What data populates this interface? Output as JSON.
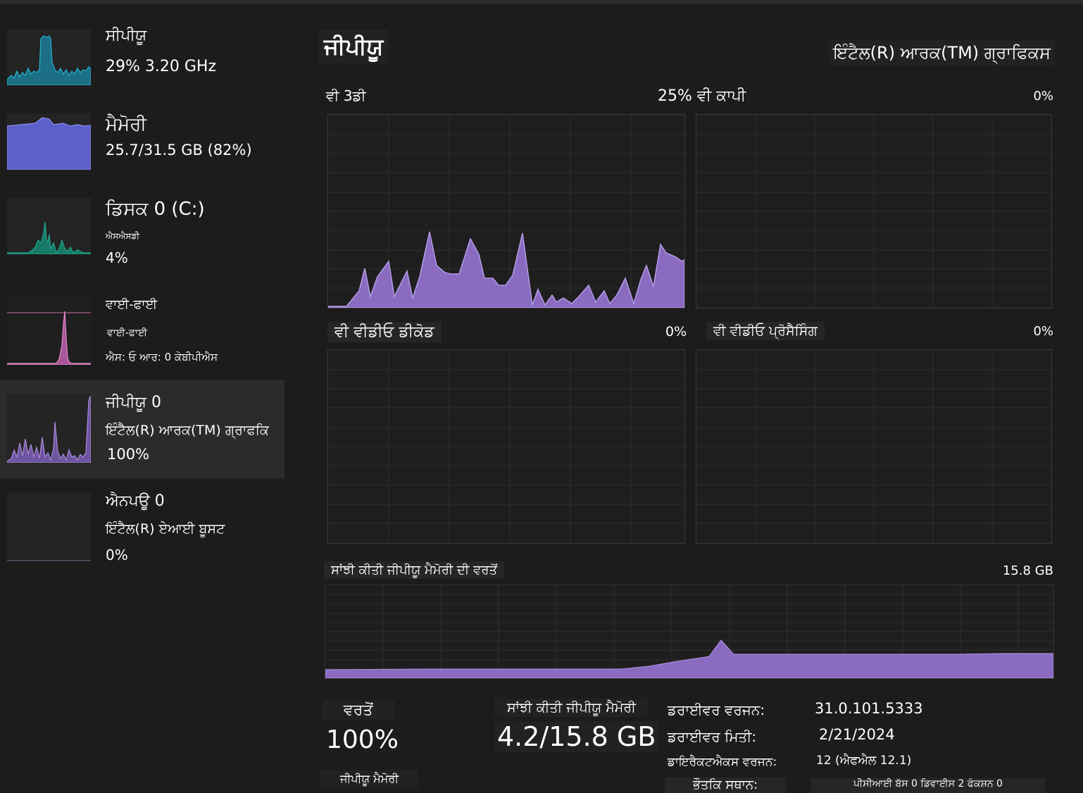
{
  "colors": {
    "cpu": "#22b2d2",
    "memory": "#6b6fe0",
    "disk": "#20a48c",
    "wifi": "#e389c8",
    "gpu": "#a78bd9",
    "gpu_fill": "#8f6fc4"
  },
  "sidebar": {
    "cpu": {
      "title": "ਸੀਪੀਯੂ",
      "value": "29% 3.20 GHz"
    },
    "memory": {
      "title": "ਮੈਮੋਰੀ",
      "value": "25.7/31.5 GB (82%)"
    },
    "disk": {
      "title": "ਡਿਸਕ 0 (C:)",
      "sub": "ਐਸਐਸਡੀ",
      "value": "4%"
    },
    "wifi": {
      "title": "ਵਾਈ-ਫਾਈ",
      "sub": "ਵਾਈ-ਫਾਈ",
      "value": "ਐਸ: ਓ ਆਰ: 0 ਕੇਬੀਪੀਐਸ"
    },
    "gpu": {
      "title": "ਜੀਪੀਯੂ 0",
      "sub": "ਇੰਟੈਲ(R) ਆਰਕ(TM) ਗ੍ਰਾਫਕਿ",
      "value": "100%"
    },
    "npu": {
      "title": "ਐਨਪਊ 0",
      "sub": "ਇੰਟੈਲ(R) ਏਆਈ ਬੂਸਟ",
      "value": "0%"
    }
  },
  "main": {
    "title": "ਜੀਪੀਯੂ",
    "device": "ਇੰਟੈਲ(R) ਆਰਕ(TM) ਗ੍ਰਾਫਿਕਸ",
    "graphs": {
      "g3d": {
        "label": "ਵੀ 3ਡੀ",
        "value": "25%"
      },
      "copy": {
        "label": "ਵੀ ਕਾਪੀ",
        "value": "0%"
      },
      "decode": {
        "label": "ਵੀ ਵੀਡੀਓ ਡੀਕੋਡ",
        "value": "0%"
      },
      "processing": {
        "label": "ਵੀ ਵੀਡੀਓ ਪ੍ਰੋਸੈਸਿੰਗ",
        "value": "0%"
      },
      "shared": {
        "label": "ਸਾਂਝੀ ਕੀਤੀ ਜੀਪੀਯੂ ਮੈਮੋਰੀ ਦੀ ਵਰਤੋਂ",
        "max": "15.8 GB"
      }
    },
    "stats": {
      "usage_label": "ਵਰਤੋਂ",
      "usage_value": "100%",
      "shared_label": "ਸਾਂਝੀ ਕੀਤੀ ਜੀਪੀਯੂ ਮੈਮੋਰੀ",
      "shared_value": "4.2/15.8 GB",
      "gpu_mem_label": "ਜੀਪੀਯੂ ਮੈਮੋਰੀ"
    },
    "info": {
      "driver_version_label": "ਡਰਾਈਵਰ ਵਰਜਨ:",
      "driver_version": "31.0.101.5333",
      "driver_date_label": "ਡਰਾਈਵਰ ਮਿਤੀ:",
      "driver_date": "2/21/2024",
      "directx_label": "ਡਾਇਰੈਕਟਐਕਸ ਵਰਜਨ:",
      "directx": "12 (ਐਫਐਲ 12.1)",
      "location_label": "ਭੌਤਕਿ ਸਥਾਨ:",
      "location": "ਪੀਸੀਆਈ ਬੱਸ 0 ਡਿਵਾਈਸ 2 ਫੰਕਸ਼ਨ 0"
    }
  }
}
